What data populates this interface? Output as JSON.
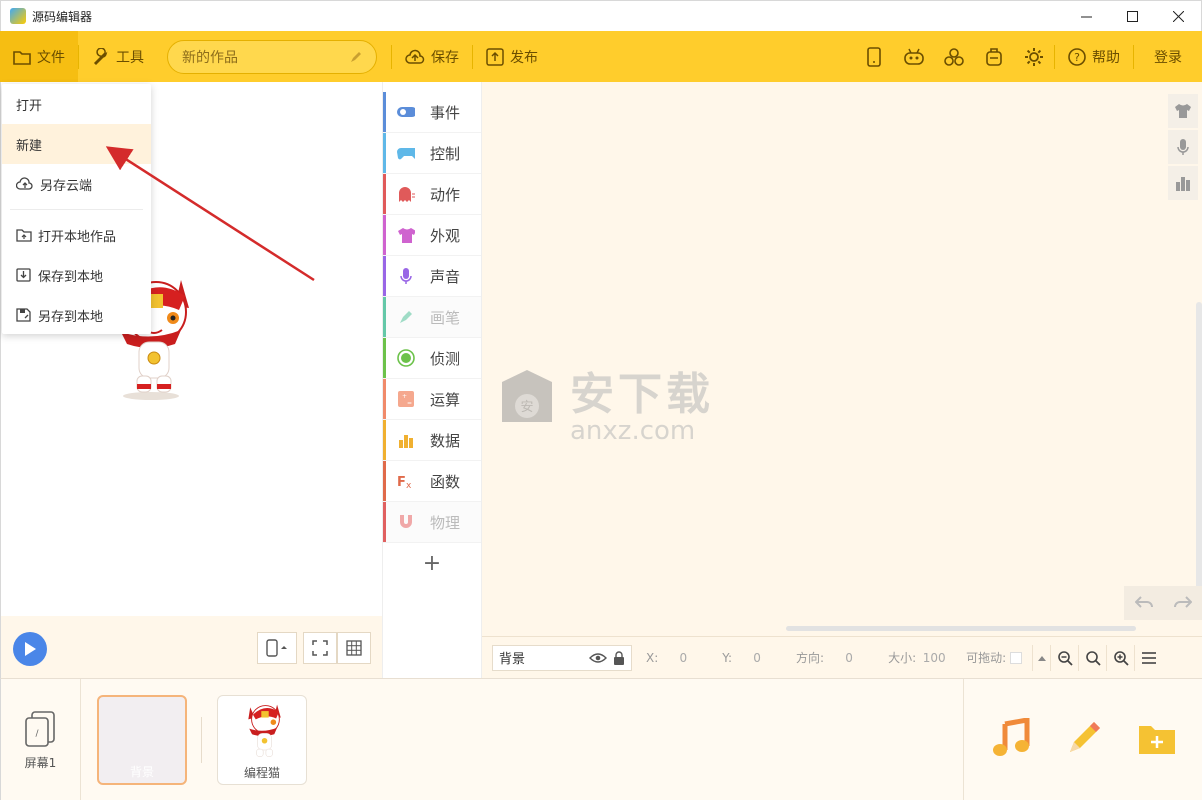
{
  "window": {
    "title": "源码编辑器",
    "minimize": "—",
    "maximize": "☐",
    "close": "✕"
  },
  "toolbar": {
    "file_label": "文件",
    "tools_label": "工具",
    "project_name": "新的作品",
    "save_label": "保存",
    "publish_label": "发布",
    "help_label": "帮助",
    "login_label": "登录"
  },
  "file_menu": {
    "items": [
      {
        "label": "打开"
      },
      {
        "label": "新建"
      },
      {
        "label": "另存云端"
      },
      {
        "label": "打开本地作品"
      },
      {
        "label": "保存到本地"
      },
      {
        "label": "另存到本地"
      }
    ]
  },
  "categories": [
    {
      "label": "事件",
      "color": "#5b8dd9"
    },
    {
      "label": "控制",
      "color": "#5fb8e8"
    },
    {
      "label": "动作",
      "color": "#e05a5a"
    },
    {
      "label": "外观",
      "color": "#cf63cf"
    },
    {
      "label": "声音",
      "color": "#9966e6"
    },
    {
      "label": "画笔",
      "color": "#64c8a8"
    },
    {
      "label": "侦测",
      "color": "#6cc24a"
    },
    {
      "label": "运算",
      "color": "#f08a6a"
    },
    {
      "label": "数据",
      "color": "#f0b030"
    },
    {
      "label": "函数",
      "color": "#e06a4a"
    },
    {
      "label": "物理",
      "color": "#e06060"
    }
  ],
  "add_category": "+",
  "watermark": {
    "cn": "安下载",
    "en": "anxz.com"
  },
  "properties": {
    "object_name": "背景",
    "x_label": "X:",
    "x_value": "0",
    "y_label": "Y:",
    "y_value": "0",
    "direction_label": "方向:",
    "direction_value": "0",
    "size_label": "大小:",
    "size_value": "100",
    "draggable_label": "可拖动:"
  },
  "bottom": {
    "screen_label": "屏幕1",
    "sprites": [
      {
        "label": "背景"
      },
      {
        "label": "编程猫"
      }
    ]
  }
}
